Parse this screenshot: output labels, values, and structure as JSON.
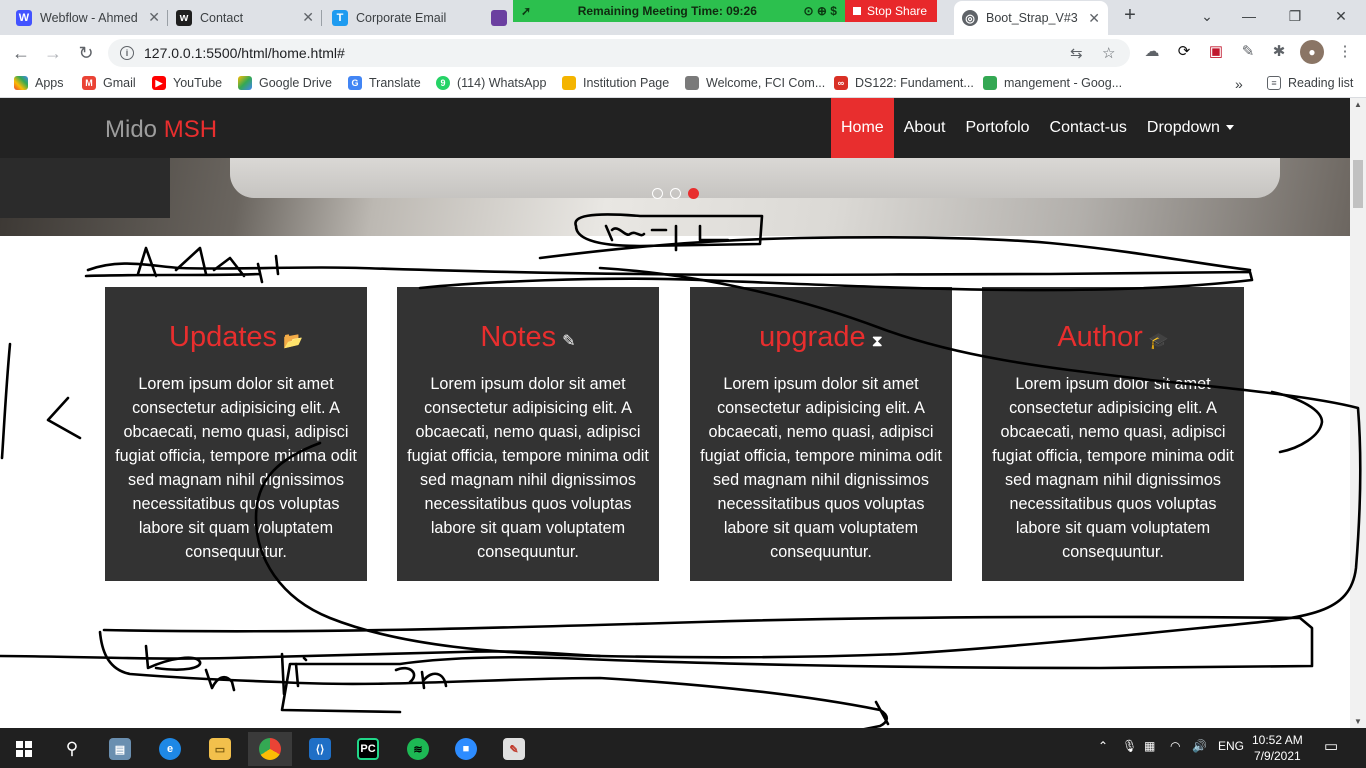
{
  "browser": {
    "tabs": [
      {
        "title": "Webflow - Ahmed",
        "fav": "W",
        "color": "#4353ff"
      },
      {
        "title": "Contact",
        "fav": "w",
        "color": "#1f1f1f"
      },
      {
        "title": "Corporate Email",
        "fav": "T",
        "color": "#1e9bf0"
      },
      {
        "title": "Boot_Strap_V#3",
        "fav": "globe-icon",
        "color": "#5f6368"
      }
    ],
    "url": "127.0.0.1:5500/html/home.html#",
    "reading_list": "Reading list"
  },
  "meeting": {
    "remaining": "Remaining Meeting Time: 09:26",
    "stop": "Stop Share",
    "colors": {
      "bar": "#2cc04e",
      "stop": "#e8282b"
    }
  },
  "bookmarks": [
    {
      "label": "Apps",
      "color": "#ea4335"
    },
    {
      "label": "Gmail",
      "color": "#ea4335"
    },
    {
      "label": "YouTube",
      "color": "#ff0000"
    },
    {
      "label": "Google Drive",
      "color": "#34a853"
    },
    {
      "label": "Translate",
      "color": "#4285f4"
    },
    {
      "label": "(114) WhatsApp",
      "color": "#25d366"
    },
    {
      "label": "Institution Page",
      "color": "#f4b400"
    },
    {
      "label": "Welcome, FCI Com...",
      "color": "#7a7a7a"
    },
    {
      "label": "DS122: Fundament...",
      "color": "#d93025"
    },
    {
      "label": "mangement - Goog...",
      "color": "#34a853"
    }
  ],
  "site": {
    "brand": {
      "first": "Mido",
      "accent": "MSH"
    },
    "nav": [
      {
        "label": "Home",
        "active": true
      },
      {
        "label": "About"
      },
      {
        "label": "Portofolo"
      },
      {
        "label": "Contact-us"
      },
      {
        "label": "Dropdown"
      }
    ],
    "accent_color": "#e82e2e",
    "cards": [
      {
        "title": "Updates",
        "icon": "folder-open-icon",
        "glyph": "📂",
        "text": "Lorem ipsum dolor sit amet consectetur adipisicing elit. A obcaecati, nemo quasi, adipisci fugiat officia, tempore minima odit sed magnam nihil dignissimos necessitatibus quos voluptas labore sit quam voluptatem consequuntur."
      },
      {
        "title": "Notes",
        "icon": "edit-icon",
        "glyph": "✎",
        "text": "Lorem ipsum dolor sit amet consectetur adipisicing elit. A obcaecati, nemo quasi, adipisci fugiat officia, tempore minima odit sed magnam nihil dignissimos necessitatibus quos voluptas labore sit quam voluptatem consequuntur."
      },
      {
        "title": "upgrade",
        "icon": "hourglass-icon",
        "glyph": "⧗",
        "text": "Lorem ipsum dolor sit amet consectetur adipisicing elit. A obcaecati, nemo quasi, adipisci fugiat officia, tempore minima odit sed magnam nihil dignissimos necessitatibus quos voluptas labore sit quam voluptatem consequuntur."
      },
      {
        "title": "Author",
        "icon": "graduation-cap-icon",
        "glyph": "🎓",
        "text": "Lorem ipsum dolor sit amet consectetur adipisicing elit. A obcaecati, nemo quasi, adipisci fugiat officia, tempore minima odit sed magnam nihil dignissimos necessitatibus quos voluptas labore sit quam voluptatem consequuntur."
      }
    ]
  },
  "taskbar": {
    "lang": "ENG",
    "time": "10:52 AM",
    "date": "7/9/2021"
  }
}
